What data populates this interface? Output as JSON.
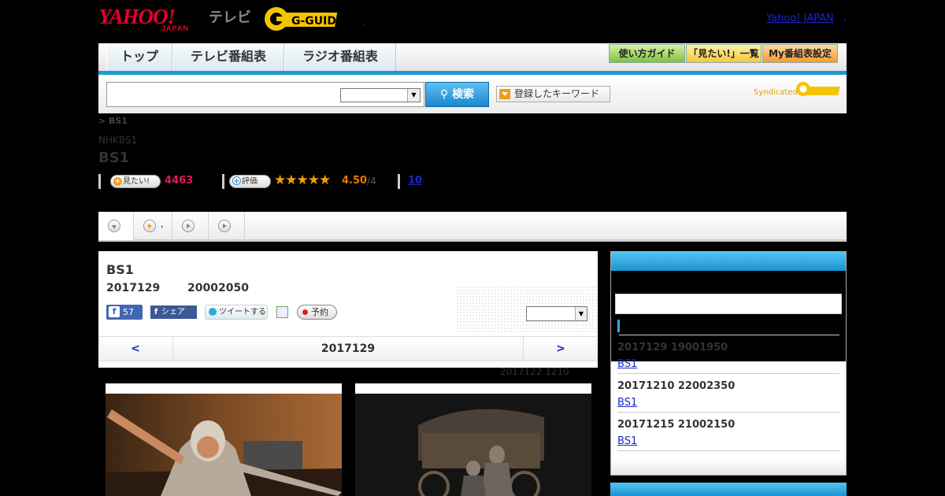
{
  "header": {
    "logo_yahoo": "YAHOO!",
    "logo_japan": "JAPAN",
    "logo_tv": "テレビ",
    "logo_gguide": "G-GUIDE",
    "logo_dot": ",",
    "yahoo_japan_link": "Yahoo! JAPAN",
    "link_dot": ","
  },
  "nav": {
    "tabs": [
      "トップ",
      "テレビ番組表",
      "ラジオ番組表"
    ],
    "buttons": [
      "使い方ガイド",
      "「見たい!」一覧",
      "My番組表設定"
    ]
  },
  "search": {
    "button": "検索",
    "keyword_button": "登録したキーワード",
    "syndicated": "Syndicated"
  },
  "breadcrumb": "> BS1",
  "network": "NHKBS1",
  "channel_title": "BS1",
  "stats": {
    "want_label": "見たい!",
    "want_count": "4463",
    "rate_label": "評価",
    "stars": "★★★★★",
    "score": "4.50",
    "score_of": "/4",
    "reviews": "10"
  },
  "tabs": {
    "tab2_label": ","
  },
  "program": {
    "title": "BS1",
    "date": "2017129",
    "time": "20002050",
    "fb_like_count": "57",
    "fb_share_label": "シェア",
    "tweet_label": "ツイートする",
    "reserve_label": "予約",
    "prev": "<",
    "current_day": "2017129",
    "next": ">",
    "update_note": "2017122  1210"
  },
  "side": {
    "items": [
      {
        "datetime": "2017129  19001950",
        "link": "BS1"
      },
      {
        "datetime": "20171210  22002350",
        "link": "BS1"
      },
      {
        "datetime": "20171215  21002150",
        "link": "BS1"
      }
    ]
  },
  "colors": {
    "accent_blue": "#1b9ad6",
    "yahoo_red": "#e6002d",
    "want_pink": "#e0185a",
    "star_orange": "#f2a300"
  }
}
